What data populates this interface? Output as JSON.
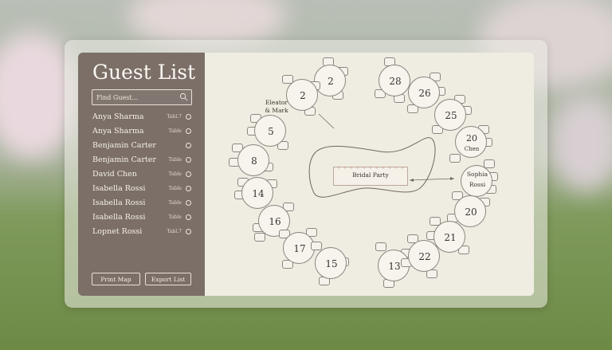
{
  "sidebar": {
    "title": "Guest List",
    "search_placeholder": "Find Guest...",
    "guests": [
      {
        "name": "Anya Sharma",
        "table": "Tabl.7"
      },
      {
        "name": "Anya Sharma",
        "table": "Table"
      },
      {
        "name": "Benjamin Carter",
        "table": ""
      },
      {
        "name": "Benjamin Carter",
        "table": "Table"
      },
      {
        "name": "David Chen",
        "table": "Table"
      },
      {
        "name": "Isabella Rossi",
        "table": "Table"
      },
      {
        "name": "Isabella Rossi",
        "table": "Table"
      },
      {
        "name": "Isabella Rossi",
        "table": "Table"
      },
      {
        "name": "Lopnet Rossi",
        "table": "Tabl.7"
      }
    ],
    "print_label": "Print Map",
    "export_label": "Export List"
  },
  "map": {
    "bridal_party_label": "Bridal Party",
    "eleator_label_line1": "Eleator",
    "eleator_label_line2": "& Mark",
    "sophia_label_line1": "Sophia",
    "sophia_label_line2": "Rossi",
    "tables": {
      "t2a": "2",
      "t2b": "2",
      "t28": "28",
      "t26": "26",
      "t5": "5",
      "t25": "25",
      "t20a": "20",
      "t20a_sub": "Chen",
      "t8": "8",
      "t14": "14",
      "t16": "16",
      "t20b": "20",
      "t21": "21",
      "t17": "17",
      "t15": "15",
      "t13": "13",
      "t22": "22"
    }
  }
}
